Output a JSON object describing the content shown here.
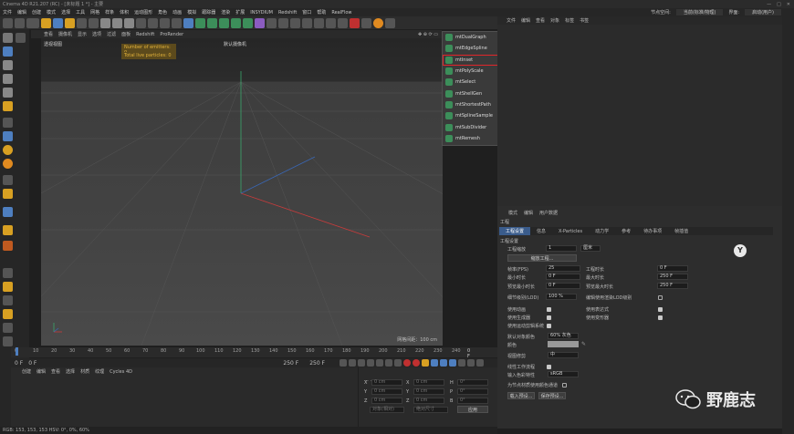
{
  "titlebar": {
    "title": "Cinema 4D R21.207 (RC) - [未标题 1 *] - 主要"
  },
  "menubar": {
    "items": [
      "文件",
      "编辑",
      "创建",
      "模式",
      "选择",
      "工具",
      "网格",
      "样条",
      "体积",
      "运动图形",
      "角色",
      "动画",
      "模拟",
      "跟踪器",
      "渲染",
      "扩展",
      "INSYDIUM",
      "Redshift",
      "窗口",
      "帮助",
      "RealFlow"
    ],
    "right_labels": [
      "节点空间:",
      "当前(标准/物理)",
      "界面:",
      "启动(用户)"
    ]
  },
  "viewport": {
    "menu": [
      "查看",
      "摄像机",
      "显示",
      "选项",
      "过滤",
      "面板",
      "Redshift",
      "ProRender"
    ],
    "label": "透视视图",
    "camera": "默认摄像机",
    "hud_emitters": "Number of emitters: 0",
    "hud_particles": "Total live particles: 0",
    "grid_scale": "网格间距：100 cm"
  },
  "popup": {
    "items": [
      "mtDualGraph",
      "mtEdgeSpline",
      "mtInset",
      "mtPolyScale",
      "mtSelect",
      "mtShellGen",
      "mtShortestPath",
      "mtSplineSample",
      "mtSubDivider",
      "mtRemesh"
    ]
  },
  "objects_panel": {
    "menu": [
      "文件",
      "编辑",
      "查看",
      "对象",
      "标签",
      "书签"
    ]
  },
  "attributes": {
    "menu": [
      "模式",
      "编辑",
      "用户数据"
    ],
    "title": "工程",
    "tabs": [
      "工程设置",
      "信息",
      "X-Particles",
      "动力学",
      "参考",
      "待办事项",
      "帧插值"
    ],
    "section": "工程设置",
    "scale_label": "工程缩放",
    "scale_value": "1",
    "scale_unit": "厘米",
    "scale_button": "缩放工程...",
    "fps_label": "帧率(FPS)",
    "fps_value": "25",
    "time_label": "工程时长",
    "time_value": "0 F",
    "min_label": "最小时长",
    "min_value": "0 F",
    "max_label": "最大时长",
    "max_value": "250 F",
    "pmin_label": "预览最小时长",
    "pmin_value": "0 F",
    "pmax_label": "预览最大时长",
    "pmax_value": "250 F",
    "lod_label": "细节级别(LOD)",
    "lod_value": "100 %",
    "lod_render_label": "编辑使用渲染LOD级别",
    "anim_label": "使用动画",
    "expr_label": "使用表达式",
    "gen_label": "使用生成器",
    "deform_label": "使用变形器",
    "motion_label": "使用运动剪辑系统",
    "default_color_label": "默认对象颜色",
    "default_color_value": "60% 灰色",
    "color_label": "颜色",
    "view_clip_label": "视图修剪",
    "view_clip_value": "中",
    "linear_label": "线性工作流程",
    "input_color_label": "输入色彩特性",
    "input_color_value": "sRGB",
    "node_color_label": "为节点材质使用颜色通道",
    "load_button": "载入预设...",
    "save_button": "保存预设..."
  },
  "timeline": {
    "ticks": [
      "0",
      "10",
      "20",
      "30",
      "40",
      "50",
      "60",
      "70",
      "80",
      "90",
      "100",
      "110",
      "120",
      "130",
      "140",
      "150",
      "160",
      "170",
      "180",
      "190",
      "200",
      "210",
      "220",
      "230",
      "240"
    ],
    "end": "0 F"
  },
  "transport": {
    "start": "0 F",
    "current": "0 F",
    "end1": "250 F",
    "end2": "250 F"
  },
  "material": {
    "menu": [
      "创建",
      "编辑",
      "查看",
      "选择",
      "材质",
      "纹理",
      "Cycles 4D"
    ]
  },
  "coords": {
    "rows": [
      [
        "X",
        "0 cm",
        "X",
        "0 cm",
        "H",
        "0°"
      ],
      [
        "Y",
        "0 cm",
        "Y",
        "0 cm",
        "P",
        "0°"
      ],
      [
        "Z",
        "0 cm",
        "Z",
        "0 cm",
        "B",
        "0°"
      ]
    ],
    "mode1": "对象(相对)",
    "mode2": "绝对尺寸",
    "apply": "应用"
  },
  "status": {
    "text": "RGB: 153, 153, 153  HSV: 0°, 0%, 60%"
  },
  "watermark": {
    "text": "野鹿志"
  },
  "colors": {
    "accent": "#3a5c8c",
    "highlight_box": "#e0262b",
    "arrow": "#e0262b",
    "hud": "#e2b23b",
    "icon_green": "#3c8e5a"
  }
}
